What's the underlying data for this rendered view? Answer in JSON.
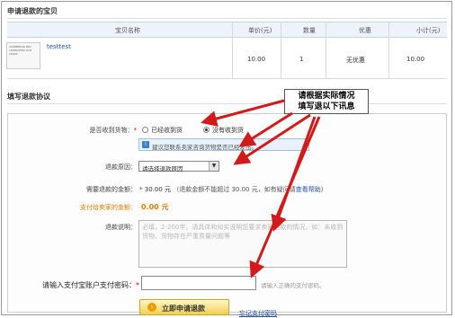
{
  "section1": {
    "title": "申请退款的宝贝"
  },
  "table": {
    "headers": [
      "宝贝名称",
      "单价(元)",
      "数量",
      "优惠",
      "小计(元)"
    ],
    "row": {
      "name": "testtest",
      "thumb_text": "2008MEILIN MIN 19600/3000-SLB 19000",
      "price": "10.00",
      "qty": "1",
      "discount": "无优惠",
      "subtotal": "10.00"
    }
  },
  "section2": {
    "title": "填写退款协议"
  },
  "callout": {
    "line1": "请根据实际情况",
    "line2": "填写退以下讯息"
  },
  "form": {
    "received_label": "是否收到货物：",
    "received_opt1": "已经收到货",
    "received_opt2": "没有收到货",
    "notice": "建议您联系卖家咨询货物是否已经发出。",
    "reason_label": "退款原因：",
    "reason_value": "请选择退款原因",
    "amount_label": "需要退款的金额：",
    "amount_value": "30.00 元",
    "amount_note": "（退款金额不能超过 30.00 元，如有疑问请",
    "amount_help": "查看帮助",
    "amount_note_end": "）",
    "pay_label": "支付给卖家的金额：",
    "pay_value": "0.00 元",
    "desc_label": "退款说明：",
    "desc_placeholder": "必填，2-200字，请具体和如实说明您要求卖家退款的情况，如：未收到货物、货物存在严重质量问题等",
    "pwd_label": "请输入支付宝账户支付密码：",
    "pwd_hint": "请输入正确的支付密码。",
    "submit_label": "立即申请退款",
    "forgot_link": "忘记支付密码"
  },
  "colors": {
    "orange": "#e07b00",
    "link": "#2050a8",
    "arrow": "#d21a1a"
  }
}
